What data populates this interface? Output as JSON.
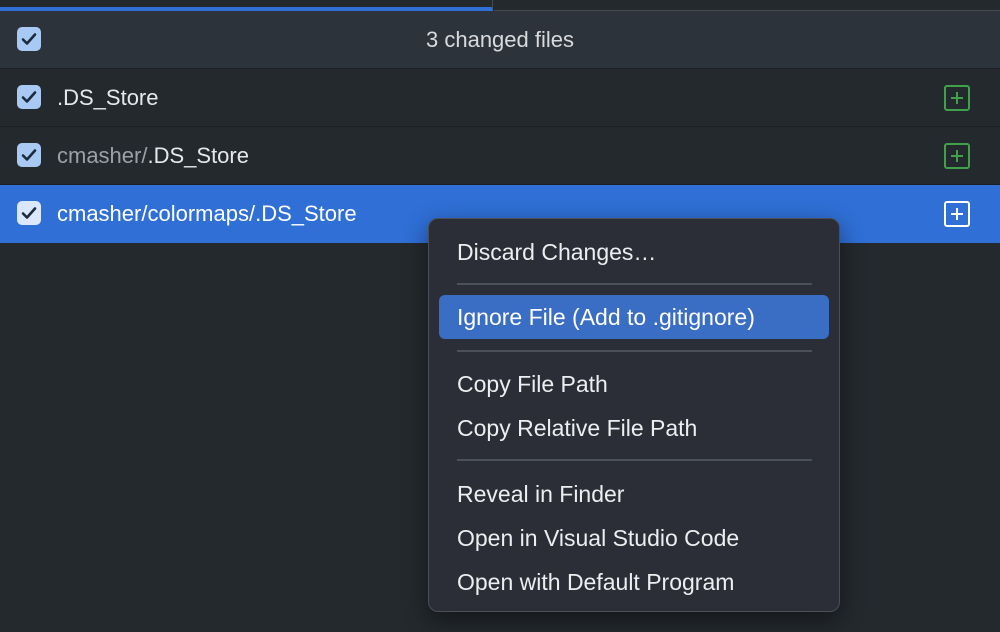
{
  "header": {
    "title": "3 changed files",
    "select_all_checked": true
  },
  "files": [
    {
      "dir": "",
      "name": ".DS_Store",
      "checked": true,
      "status_icon": "added-plus-icon",
      "selected": false
    },
    {
      "dir": "cmasher/",
      "name": ".DS_Store",
      "checked": true,
      "status_icon": "added-plus-icon",
      "selected": false
    },
    {
      "dir": "cmasher/colormaps/",
      "name": ".DS_Store",
      "checked": true,
      "status_icon": "added-plus-icon",
      "selected": true
    }
  ],
  "context_menu": {
    "items": [
      {
        "label": "Discard Changes…"
      },
      {
        "label": "Ignore File (Add to .gitignore)",
        "highlighted": true
      },
      {
        "label": "Copy File Path"
      },
      {
        "label": "Copy Relative File Path"
      },
      {
        "label": "Reveal in Finder"
      },
      {
        "label": "Open in Visual Studio Code"
      },
      {
        "label": "Open with Default Program"
      }
    ]
  },
  "colors": {
    "accent": "#2f6fd6",
    "added": "#3fa14a",
    "background": "#24292e",
    "menu_background": "#2b2e36",
    "menu_highlight": "#3a6dc4"
  }
}
